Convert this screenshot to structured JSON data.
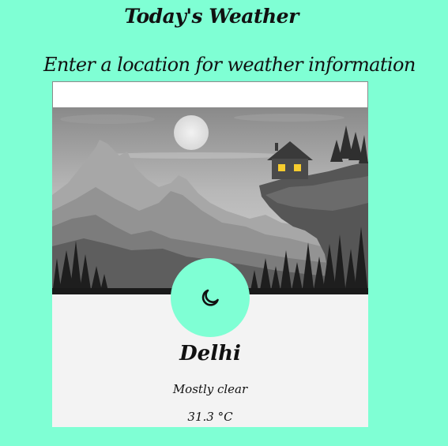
{
  "header": {
    "title": "Today's Weather",
    "prompt": "Enter a location for weather information"
  },
  "search": {
    "value": "",
    "placeholder": ""
  },
  "weather": {
    "city": "Delhi",
    "condition": "Mostly clear",
    "temperature": "31.3 °C",
    "icon": "crescent-moon-icon"
  },
  "colors": {
    "background": "#7fffd4",
    "card": "#f3f3f3",
    "icon_circle": "#7fffd4"
  }
}
